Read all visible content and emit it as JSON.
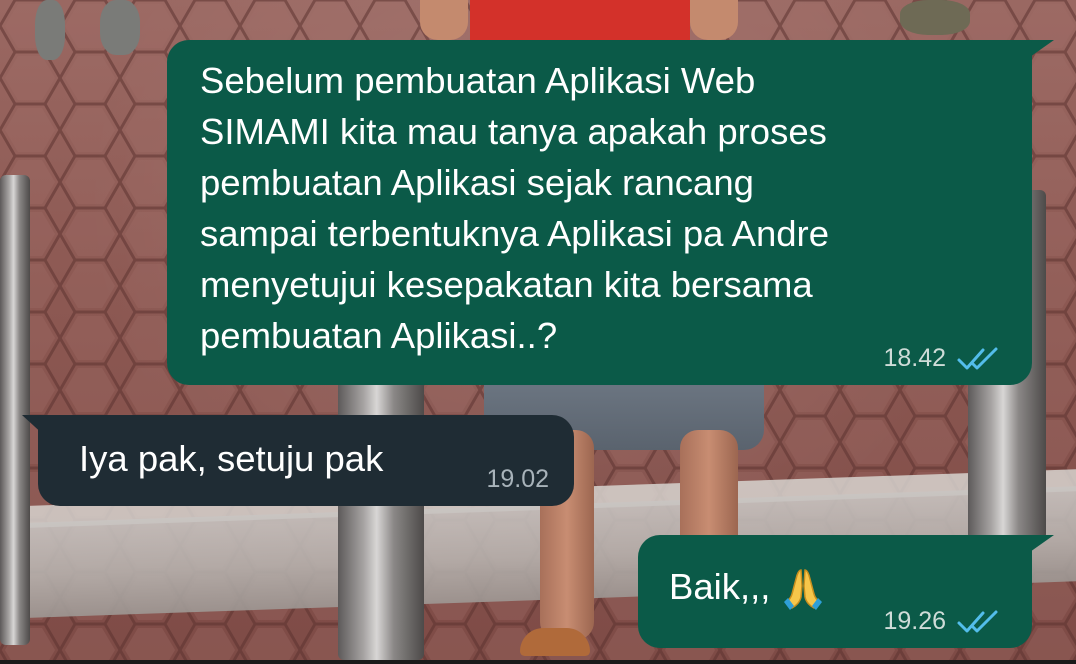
{
  "chat": {
    "messages": [
      {
        "direction": "outgoing",
        "text": "Sebelum pembuatan Aplikasi Web\nSIMAMI kita mau tanya apakah proses\npembuatan Aplikasi sejak rancang\nsampai terbentuknya Aplikasi pa Andre\nmenyetujui kesepakatan kita bersama\npembuatan Aplikasi..?",
        "time": "18.42",
        "status_icon": "double-check-read-icon"
      },
      {
        "direction": "incoming",
        "text": "Iya pak, setuju pak",
        "time": "19.02"
      },
      {
        "direction": "outgoing",
        "text": "Baik,,,",
        "emoji": "folded-hands-emoji",
        "time": "19.26",
        "status_icon": "double-check-read-icon"
      }
    ]
  },
  "colors": {
    "outgoing_bubble": "#0b5a48",
    "incoming_bubble": "#1f2c34",
    "read_ticks": "#53bdeb",
    "message_text": "#ffffff"
  },
  "background": {
    "type": "photo-wallpaper",
    "description_icon": "wallpaper-photo"
  }
}
